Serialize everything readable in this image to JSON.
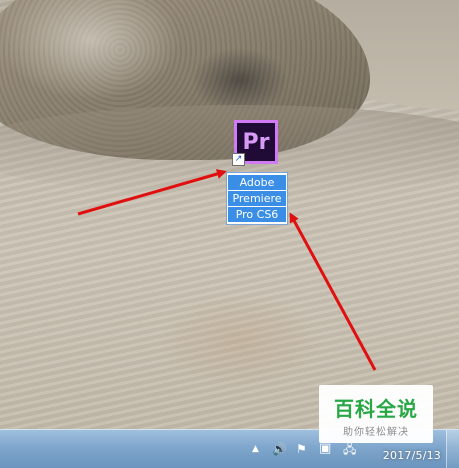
{
  "desktop": {
    "shortcut": {
      "icon_text": "Pr",
      "label_lines": [
        "Adobe",
        "Premiere",
        "Pro CS6"
      ],
      "shortcut_arrow": "↗",
      "icon_name": "adobe-premiere-pro-icon",
      "accent": "#cf7cf2",
      "selection_color": "#3a8ee6"
    },
    "annotation_arrows": {
      "color": "#e01010"
    }
  },
  "taskbar": {
    "tray": {
      "show_hidden_icon": "▲",
      "volume_icon": "🔊",
      "flag_icon": "⚑",
      "network_icon": "🖧"
    },
    "clock": {
      "date": "2017/5/13"
    }
  },
  "watermark": {
    "title": "百科全说",
    "subtitle": "助你轻松解决"
  }
}
